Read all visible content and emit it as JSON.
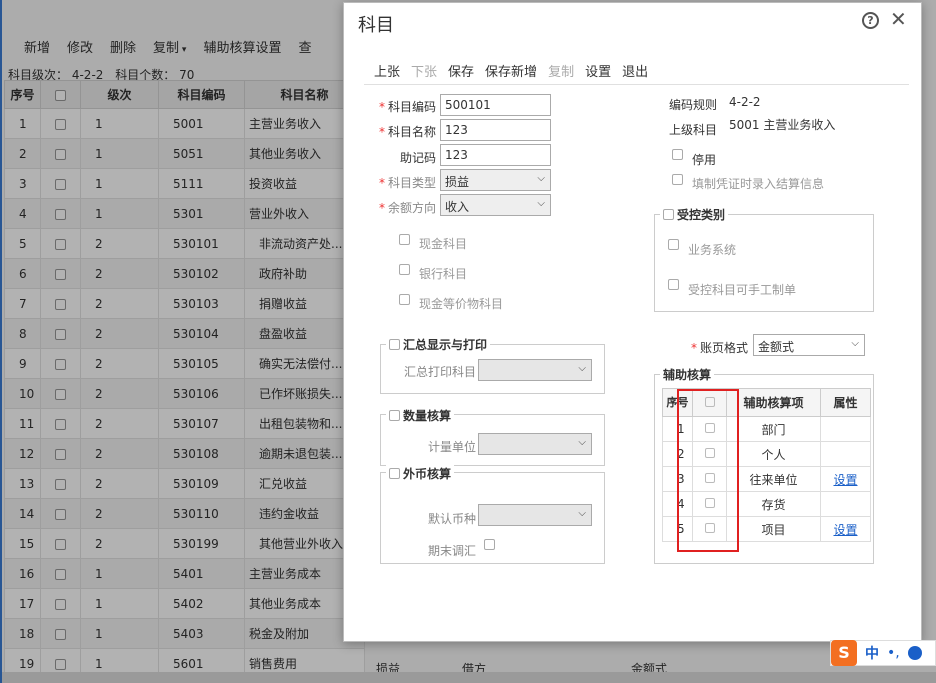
{
  "toolbar": {
    "items": [
      "新增",
      "修改",
      "删除",
      "复制",
      "辅助核算设置",
      "查"
    ]
  },
  "info": {
    "level_label": "科目级次：",
    "level_value": "4-2-2",
    "count_label": "科目个数：",
    "count_value": "70"
  },
  "grid": {
    "headers": [
      "序号",
      "",
      "级次",
      "科目编码",
      "科目名称"
    ],
    "rows": [
      {
        "seq": "1",
        "level": "1",
        "code": "5001",
        "name": "主营业务收入",
        "sub": false
      },
      {
        "seq": "2",
        "level": "1",
        "code": "5051",
        "name": "其他业务收入",
        "sub": false
      },
      {
        "seq": "3",
        "level": "1",
        "code": "5111",
        "name": "投资收益",
        "sub": false
      },
      {
        "seq": "4",
        "level": "1",
        "code": "5301",
        "name": "营业外收入",
        "sub": false
      },
      {
        "seq": "5",
        "level": "2",
        "code": "530101",
        "name": "非流动资产处...",
        "sub": true
      },
      {
        "seq": "6",
        "level": "2",
        "code": "530102",
        "name": "政府补助",
        "sub": true
      },
      {
        "seq": "7",
        "level": "2",
        "code": "530103",
        "name": "捐赠收益",
        "sub": true
      },
      {
        "seq": "8",
        "level": "2",
        "code": "530104",
        "name": "盘盈收益",
        "sub": true
      },
      {
        "seq": "9",
        "level": "2",
        "code": "530105",
        "name": "确实无法偿付...",
        "sub": true
      },
      {
        "seq": "10",
        "level": "2",
        "code": "530106",
        "name": "已作坏账损失...",
        "sub": true
      },
      {
        "seq": "11",
        "level": "2",
        "code": "530107",
        "name": "出租包装物和...",
        "sub": true
      },
      {
        "seq": "12",
        "level": "2",
        "code": "530108",
        "name": "逾期未退包装...",
        "sub": true
      },
      {
        "seq": "13",
        "level": "2",
        "code": "530109",
        "name": "汇兑收益",
        "sub": true
      },
      {
        "seq": "14",
        "level": "2",
        "code": "530110",
        "name": "违约金收益",
        "sub": true
      },
      {
        "seq": "15",
        "level": "2",
        "code": "530199",
        "name": "其他营业外收入",
        "sub": true
      },
      {
        "seq": "16",
        "level": "1",
        "code": "5401",
        "name": "主营业务成本",
        "sub": false
      },
      {
        "seq": "17",
        "level": "1",
        "code": "5402",
        "name": "其他业务成本",
        "sub": false
      },
      {
        "seq": "18",
        "level": "1",
        "code": "5403",
        "name": "税金及附加",
        "sub": false
      },
      {
        "seq": "19",
        "level": "1",
        "code": "5601",
        "name": "销售费用",
        "sub": false
      }
    ],
    "row19_extra": [
      "损益",
      "借方",
      "金额式"
    ]
  },
  "dialog": {
    "title": "科目",
    "help": "?",
    "close": "✕",
    "toolbar": [
      {
        "label": "上张",
        "disabled": false
      },
      {
        "label": "下张",
        "disabled": true
      },
      {
        "label": "保存",
        "disabled": false
      },
      {
        "label": "保存新增",
        "disabled": false
      },
      {
        "label": "复制",
        "disabled": true
      },
      {
        "label": "设置",
        "disabled": false
      },
      {
        "label": "退出",
        "disabled": false
      }
    ],
    "form": {
      "code_label": "科目编码",
      "code_value": "500101",
      "name_label": "科目名称",
      "name_value": "123",
      "mnemonic_label": "助记码",
      "mnemonic_value": "123",
      "type_label": "科目类型",
      "type_value": "损益",
      "direction_label": "余额方向",
      "direction_value": "收入",
      "cash_label": "现金科目",
      "bank_label": "银行科目",
      "cash_eq_label": "现金等价物科目"
    },
    "right": {
      "rule_label": "编码规则",
      "rule_value": "4-2-2",
      "parent_label": "上级科目",
      "parent_value": "5001  主营业务收入",
      "disable_label": "停用",
      "settle_label": "填制凭证时录入结算信息",
      "controlled_legend": "受控类别",
      "biz_system_label": "业务系统",
      "manual_label": "受控科目可手工制单",
      "page_format_label": "账页格式",
      "page_format_value": "金额式"
    },
    "summary": {
      "legend": "汇总显示与打印",
      "print_label": "汇总打印科目"
    },
    "quantity": {
      "legend": "数量核算",
      "unit_label": "计量单位"
    },
    "foreign": {
      "legend": "外币核算",
      "currency_label": "默认币种",
      "adjust_label": "期末调汇"
    },
    "aux": {
      "legend": "辅助核算",
      "headers": [
        "序号",
        "",
        "辅助核算项",
        "属性"
      ],
      "rows": [
        {
          "seq": "1",
          "item": "部门",
          "attr": ""
        },
        {
          "seq": "2",
          "item": "个人",
          "attr": ""
        },
        {
          "seq": "3",
          "item": "往来单位",
          "attr": "设置"
        },
        {
          "seq": "4",
          "item": "存货",
          "attr": ""
        },
        {
          "seq": "5",
          "item": "项目",
          "attr": "设置"
        }
      ]
    }
  },
  "ime": {
    "logo": "S",
    "mode": "中",
    "punct": "•,"
  }
}
